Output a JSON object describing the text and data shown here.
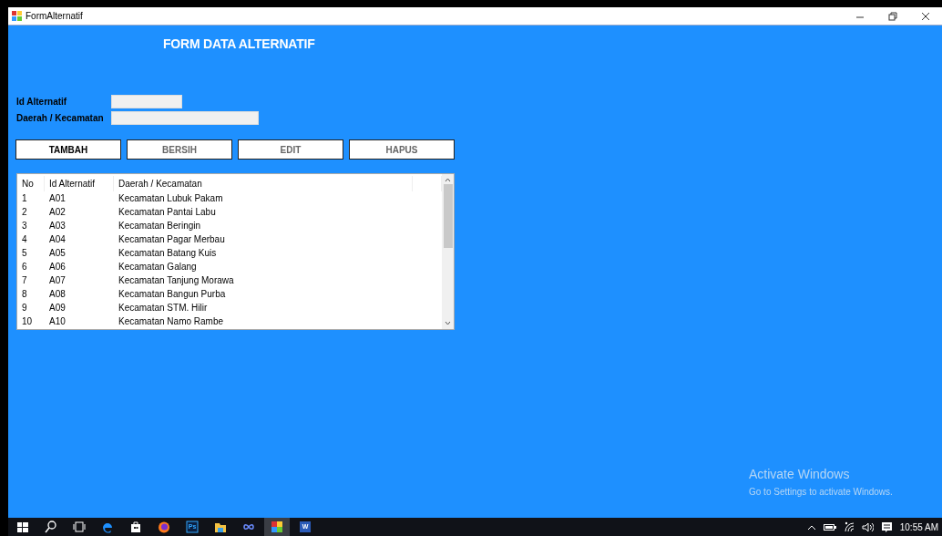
{
  "window": {
    "title": "FormAlternatif"
  },
  "form": {
    "heading": "FORM DATA ALTERNATIF",
    "fields": [
      {
        "label": "Id Alternatif"
      },
      {
        "label": "Daerah / Kecamatan"
      }
    ],
    "buttons": [
      {
        "label": "TAMBAH",
        "disabled": false
      },
      {
        "label": "BERSIH",
        "disabled": true
      },
      {
        "label": "EDIT",
        "disabled": true
      },
      {
        "label": "HAPUS",
        "disabled": true
      }
    ]
  },
  "table": {
    "columns": [
      "No",
      "Id Alternatif",
      "Daerah / Kecamatan"
    ],
    "rows": [
      [
        "1",
        "A01",
        "Kecamatan Lubuk Pakam"
      ],
      [
        "2",
        "A02",
        "Kecamatan Pantai Labu"
      ],
      [
        "3",
        "A03",
        "Kecamatan Beringin"
      ],
      [
        "4",
        "A04",
        "Kecamatan Pagar Merbau"
      ],
      [
        "5",
        "A05",
        "Kecamatan Batang Kuis"
      ],
      [
        "6",
        "A06",
        "Kecamatan Galang"
      ],
      [
        "7",
        "A07",
        "Kecamatan Tanjung Morawa"
      ],
      [
        "8",
        "A08",
        "Kecamatan Bangun Purba"
      ],
      [
        "9",
        "A09",
        "Kecamatan STM. Hilir"
      ],
      [
        "10",
        "A10",
        "Kecamatan Namo Rambe"
      ]
    ]
  },
  "activation_notice": {
    "title": "Activate Windows",
    "message": "Go to Settings to activate Windows."
  },
  "taskbar": {
    "apps": [
      {
        "kind": "start",
        "selected": false
      },
      {
        "kind": "search",
        "selected": false
      },
      {
        "kind": "taskview",
        "selected": false
      },
      {
        "kind": "edge",
        "selected": false
      },
      {
        "kind": "store",
        "selected": false
      },
      {
        "kind": "firefox",
        "selected": false
      },
      {
        "kind": "photoshop",
        "text": "Ps",
        "selected": false
      },
      {
        "kind": "folder",
        "selected": false
      },
      {
        "kind": "infinity",
        "selected": false
      },
      {
        "kind": "formapp",
        "selected": true
      },
      {
        "kind": "word",
        "text": "W",
        "selected": false
      }
    ],
    "clock": "10:55 AM"
  }
}
